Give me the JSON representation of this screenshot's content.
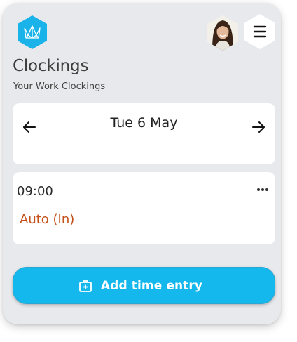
{
  "header": {
    "logo_icon": "crown-hexagon-icon",
    "avatar_icon": "user-avatar",
    "menu_icon": "hamburger-menu-icon"
  },
  "page": {
    "title": "Clockings",
    "subtitle": "Your Work Clockings"
  },
  "date_nav": {
    "prev_icon": "arrow-left-icon",
    "date": "Tue 6 May",
    "next_icon": "arrow-right-icon"
  },
  "entries": [
    {
      "time": "09:00",
      "type": "Auto (In)",
      "more_icon": "more-horizontal-icon"
    }
  ],
  "actions": {
    "add_label": "Add time entry",
    "add_icon": "medical-bag-plus-icon"
  },
  "colors": {
    "accent": "#15b8ec",
    "entry_type": "#c4501a",
    "background": "#e8e9ec"
  }
}
